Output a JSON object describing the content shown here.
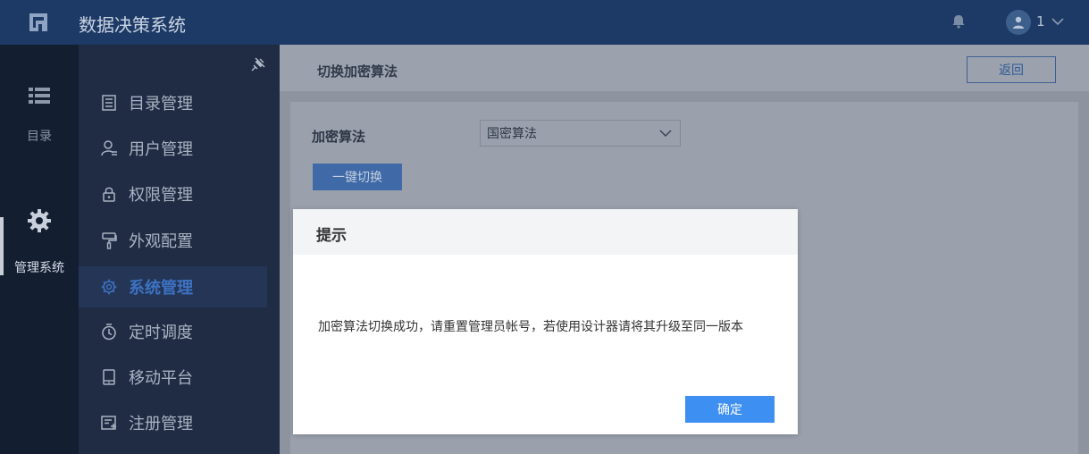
{
  "header": {
    "app_title": "数据决策系统",
    "user_name": "1"
  },
  "rail": {
    "items": [
      {
        "label": "目录",
        "icon": "list-icon"
      },
      {
        "label": "管理系统",
        "icon": "gear-icon"
      }
    ]
  },
  "menu": {
    "items": [
      {
        "label": "目录管理",
        "icon": "catalog-icon"
      },
      {
        "label": "用户管理",
        "icon": "user-icon"
      },
      {
        "label": "权限管理",
        "icon": "lock-icon"
      },
      {
        "label": "外观配置",
        "icon": "paint-roller-icon"
      },
      {
        "label": "系统管理",
        "icon": "gear-icon",
        "active": true
      },
      {
        "label": "定时调度",
        "icon": "timer-icon"
      },
      {
        "label": "移动平台",
        "icon": "tablet-icon"
      },
      {
        "label": "注册管理",
        "icon": "register-icon"
      }
    ]
  },
  "page": {
    "title": "切换加密算法",
    "back_label": "返回",
    "field_label": "加密算法",
    "select_value": "国密算法",
    "switch_label": "一键切换"
  },
  "dialog": {
    "title": "提示",
    "message": "加密算法切换成功，请重置管理员帐号，若使用设计器请将其升级至同一版本",
    "ok_label": "确定"
  },
  "colors": {
    "header_bg": "#1d3a66",
    "rail_bg": "#131e31",
    "menu_bg": "#1f2c44",
    "accent": "#3e8ff2",
    "active_menu_text": "#3d72c2"
  }
}
